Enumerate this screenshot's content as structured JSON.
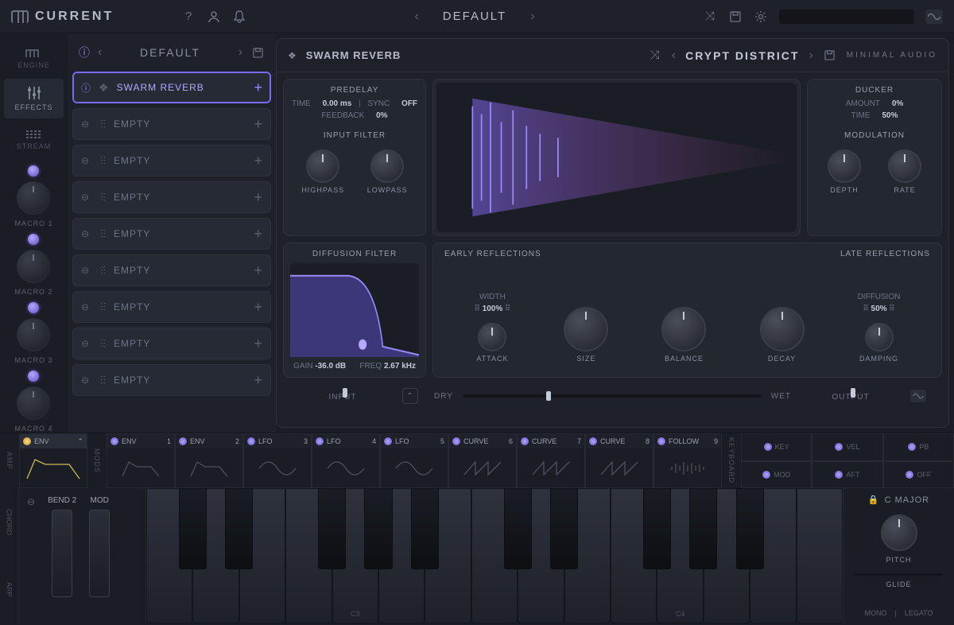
{
  "app": {
    "name": "CURRENT",
    "preset": "DEFAULT"
  },
  "leftnav": {
    "tabs": [
      {
        "label": "ENGINE"
      },
      {
        "label": "EFFECTS"
      },
      {
        "label": "STREAM"
      }
    ],
    "macros": [
      {
        "label": "MACRO 1"
      },
      {
        "label": "MACRO 2"
      },
      {
        "label": "MACRO 3"
      },
      {
        "label": "MACRO 4"
      }
    ]
  },
  "fxlist": {
    "preset": "DEFAULT",
    "slots": [
      {
        "name": "SWARM REVERB",
        "active": true
      },
      {
        "name": "EMPTY"
      },
      {
        "name": "EMPTY"
      },
      {
        "name": "EMPTY"
      },
      {
        "name": "EMPTY"
      },
      {
        "name": "EMPTY"
      },
      {
        "name": "EMPTY"
      },
      {
        "name": "EMPTY"
      },
      {
        "name": "EMPTY"
      }
    ]
  },
  "fx": {
    "name": "SWARM REVERB",
    "preset": "CRYPT DISTRICT",
    "brand": "MINIMAL AUDIO",
    "predelay": {
      "title": "PREDELAY",
      "time_lbl": "TIME",
      "time_val": "0.00 ms",
      "sync_lbl": "SYNC",
      "sync_val": "OFF",
      "fb_lbl": "FEEDBACK",
      "fb_val": "0%",
      "filter_title": "INPUT FILTER",
      "hp": "HIGHPASS",
      "lp": "LOWPASS"
    },
    "ducker": {
      "title": "DUCKER",
      "amt_lbl": "AMOUNT",
      "amt_val": "0%",
      "time_lbl": "TIME",
      "time_val": "50%",
      "mod_title": "MODULATION",
      "depth": "DEPTH",
      "rate": "RATE"
    },
    "diff": {
      "title": "DIFFUSION FILTER",
      "gain_lbl": "GAIN",
      "gain_val": "-36.0 dB",
      "freq_lbl": "FREQ",
      "freq_val": "2.67 kHz"
    },
    "refl": {
      "early": "EARLY REFLECTIONS",
      "late": "LATE REFLECTIONS",
      "width_lbl": "WIDTH",
      "width_val": "100%",
      "attack": "ATTACK",
      "size": "SIZE",
      "balance": "BALANCE",
      "decay": "DECAY",
      "diffusion_lbl": "DIFFUSION",
      "diffusion_val": "50%",
      "damping": "DAMPING"
    },
    "footer": {
      "input": "INPUT",
      "dry": "DRY",
      "wet": "WET",
      "output": "OUTPUT"
    }
  },
  "mods": {
    "amp": "AMP",
    "mods_lbl": "MODS",
    "kbd_lbl": "KEYBOARD",
    "slots": [
      {
        "name": "ENV",
        "num": ""
      },
      {
        "name": "ENV",
        "num": "1"
      },
      {
        "name": "ENV",
        "num": "2"
      },
      {
        "name": "LFO",
        "num": "3"
      },
      {
        "name": "LFO",
        "num": "4"
      },
      {
        "name": "LFO",
        "num": "5"
      },
      {
        "name": "CURVE",
        "num": "6"
      },
      {
        "name": "CURVE",
        "num": "7"
      },
      {
        "name": "CURVE",
        "num": "8"
      },
      {
        "name": "FOLLOW",
        "num": "9"
      }
    ],
    "kbd": [
      "KEY",
      "VEL",
      "PB",
      "MOD",
      "AFT",
      "OFF"
    ]
  },
  "kbd": {
    "chord": "CHORD",
    "arp": "ARP",
    "bend": "BEND",
    "bend_n": "2",
    "mod": "MOD",
    "c3": "C3",
    "c4": "C4",
    "scale": "C  MAJOR",
    "pitch": "PITCH",
    "glide": "GLIDE",
    "mono": "MONO",
    "legato": "LEGATO"
  }
}
